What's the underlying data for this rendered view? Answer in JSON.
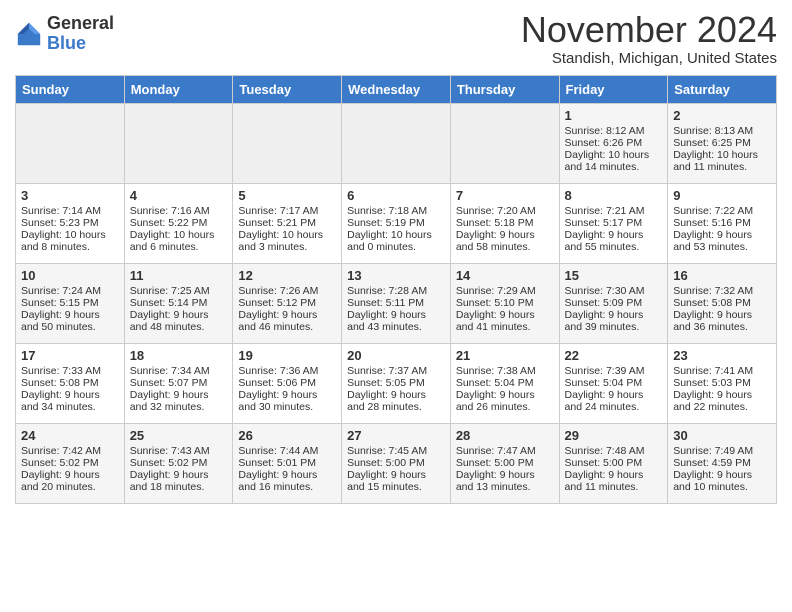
{
  "header": {
    "logo_general": "General",
    "logo_blue": "Blue",
    "month_title": "November 2024",
    "location": "Standish, Michigan, United States"
  },
  "days_of_week": [
    "Sunday",
    "Monday",
    "Tuesday",
    "Wednesday",
    "Thursday",
    "Friday",
    "Saturday"
  ],
  "weeks": [
    [
      {
        "day": "",
        "info": ""
      },
      {
        "day": "",
        "info": ""
      },
      {
        "day": "",
        "info": ""
      },
      {
        "day": "",
        "info": ""
      },
      {
        "day": "",
        "info": ""
      },
      {
        "day": "1",
        "info": "Sunrise: 8:12 AM\nSunset: 6:26 PM\nDaylight: 10 hours and 14 minutes."
      },
      {
        "day": "2",
        "info": "Sunrise: 8:13 AM\nSunset: 6:25 PM\nDaylight: 10 hours and 11 minutes."
      }
    ],
    [
      {
        "day": "3",
        "info": "Sunrise: 7:14 AM\nSunset: 5:23 PM\nDaylight: 10 hours and 8 minutes."
      },
      {
        "day": "4",
        "info": "Sunrise: 7:16 AM\nSunset: 5:22 PM\nDaylight: 10 hours and 6 minutes."
      },
      {
        "day": "5",
        "info": "Sunrise: 7:17 AM\nSunset: 5:21 PM\nDaylight: 10 hours and 3 minutes."
      },
      {
        "day": "6",
        "info": "Sunrise: 7:18 AM\nSunset: 5:19 PM\nDaylight: 10 hours and 0 minutes."
      },
      {
        "day": "7",
        "info": "Sunrise: 7:20 AM\nSunset: 5:18 PM\nDaylight: 9 hours and 58 minutes."
      },
      {
        "day": "8",
        "info": "Sunrise: 7:21 AM\nSunset: 5:17 PM\nDaylight: 9 hours and 55 minutes."
      },
      {
        "day": "9",
        "info": "Sunrise: 7:22 AM\nSunset: 5:16 PM\nDaylight: 9 hours and 53 minutes."
      }
    ],
    [
      {
        "day": "10",
        "info": "Sunrise: 7:24 AM\nSunset: 5:15 PM\nDaylight: 9 hours and 50 minutes."
      },
      {
        "day": "11",
        "info": "Sunrise: 7:25 AM\nSunset: 5:14 PM\nDaylight: 9 hours and 48 minutes."
      },
      {
        "day": "12",
        "info": "Sunrise: 7:26 AM\nSunset: 5:12 PM\nDaylight: 9 hours and 46 minutes."
      },
      {
        "day": "13",
        "info": "Sunrise: 7:28 AM\nSunset: 5:11 PM\nDaylight: 9 hours and 43 minutes."
      },
      {
        "day": "14",
        "info": "Sunrise: 7:29 AM\nSunset: 5:10 PM\nDaylight: 9 hours and 41 minutes."
      },
      {
        "day": "15",
        "info": "Sunrise: 7:30 AM\nSunset: 5:09 PM\nDaylight: 9 hours and 39 minutes."
      },
      {
        "day": "16",
        "info": "Sunrise: 7:32 AM\nSunset: 5:08 PM\nDaylight: 9 hours and 36 minutes."
      }
    ],
    [
      {
        "day": "17",
        "info": "Sunrise: 7:33 AM\nSunset: 5:08 PM\nDaylight: 9 hours and 34 minutes."
      },
      {
        "day": "18",
        "info": "Sunrise: 7:34 AM\nSunset: 5:07 PM\nDaylight: 9 hours and 32 minutes."
      },
      {
        "day": "19",
        "info": "Sunrise: 7:36 AM\nSunset: 5:06 PM\nDaylight: 9 hours and 30 minutes."
      },
      {
        "day": "20",
        "info": "Sunrise: 7:37 AM\nSunset: 5:05 PM\nDaylight: 9 hours and 28 minutes."
      },
      {
        "day": "21",
        "info": "Sunrise: 7:38 AM\nSunset: 5:04 PM\nDaylight: 9 hours and 26 minutes."
      },
      {
        "day": "22",
        "info": "Sunrise: 7:39 AM\nSunset: 5:04 PM\nDaylight: 9 hours and 24 minutes."
      },
      {
        "day": "23",
        "info": "Sunrise: 7:41 AM\nSunset: 5:03 PM\nDaylight: 9 hours and 22 minutes."
      }
    ],
    [
      {
        "day": "24",
        "info": "Sunrise: 7:42 AM\nSunset: 5:02 PM\nDaylight: 9 hours and 20 minutes."
      },
      {
        "day": "25",
        "info": "Sunrise: 7:43 AM\nSunset: 5:02 PM\nDaylight: 9 hours and 18 minutes."
      },
      {
        "day": "26",
        "info": "Sunrise: 7:44 AM\nSunset: 5:01 PM\nDaylight: 9 hours and 16 minutes."
      },
      {
        "day": "27",
        "info": "Sunrise: 7:45 AM\nSunset: 5:00 PM\nDaylight: 9 hours and 15 minutes."
      },
      {
        "day": "28",
        "info": "Sunrise: 7:47 AM\nSunset: 5:00 PM\nDaylight: 9 hours and 13 minutes."
      },
      {
        "day": "29",
        "info": "Sunrise: 7:48 AM\nSunset: 5:00 PM\nDaylight: 9 hours and 11 minutes."
      },
      {
        "day": "30",
        "info": "Sunrise: 7:49 AM\nSunset: 4:59 PM\nDaylight: 9 hours and 10 minutes."
      }
    ]
  ]
}
